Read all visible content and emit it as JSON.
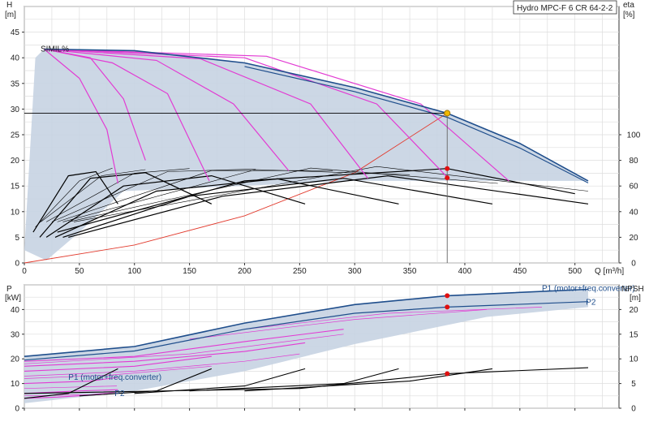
{
  "chart_data": [
    {
      "type": "line",
      "title": "Hydro MPC-F 6 CR 64-2-2",
      "top_left_tag": "SIMIL%",
      "xlabel": "Q [m³/h]",
      "x_ticks": [
        "0",
        "50",
        "100",
        "150",
        "200",
        "250",
        "300",
        "350",
        "400",
        "450",
        "500"
      ],
      "xlim": [
        0,
        540
      ],
      "left_axis": {
        "label": "H",
        "unit": "[m]",
        "ylim": [
          0,
          50
        ],
        "ticks": [
          "0",
          "5",
          "10",
          "15",
          "20",
          "25",
          "30",
          "35",
          "40",
          "45"
        ]
      },
      "right_axis": {
        "label": "eta",
        "unit": "[%]",
        "ylim_equiv": [
          0,
          200
        ],
        "ticks": [
          "0",
          "20",
          "40",
          "60",
          "80",
          "100"
        ]
      },
      "duty_point": {
        "Q": 384,
        "H": 29.2
      },
      "eff_points": [
        {
          "Q": 384,
          "H": 18.4
        },
        {
          "Q": 384,
          "H": 16.6
        }
      ],
      "grid": true,
      "series": [
        {
          "role": "envelope_max",
          "color": "#1f4e8c",
          "points": [
            [
              18,
              41.7
            ],
            [
              100,
              41.4
            ],
            [
              200,
              39.0
            ],
            [
              300,
              34.2
            ],
            [
              384,
              29.2
            ],
            [
              450,
              23.3
            ],
            [
              512,
              16.0
            ]
          ]
        },
        {
          "role": "envelope_lower",
          "color": "#1f4e8c",
          "points": [
            [
              200,
              38.3
            ],
            [
              300,
              33.4
            ],
            [
              384,
              28.4
            ],
            [
              450,
              22.4
            ],
            [
              512,
              15.6
            ]
          ]
        },
        {
          "role": "system_curve",
          "color": "#e23b2e",
          "points": [
            [
              0,
              0
            ],
            [
              100,
              3.5
            ],
            [
              200,
              9.2
            ],
            [
              300,
              17.6
            ],
            [
              384,
              29.2
            ]
          ]
        },
        {
          "role": "pump_speed_curves",
          "color": "#e23bd3",
          "curves": [
            [
              [
                18,
                41.7
              ],
              [
                50,
                36
              ],
              [
                75,
                26
              ],
              [
                85,
                15.5
              ]
            ],
            [
              [
                18,
                41.7
              ],
              [
                80,
                39
              ],
              [
                130,
                33
              ],
              [
                168,
                16
              ]
            ],
            [
              [
                18,
                41.7
              ],
              [
                120,
                39.5
              ],
              [
                190,
                31
              ],
              [
                240,
                18
              ]
            ],
            [
              [
                18,
                41.7
              ],
              [
                160,
                39.8
              ],
              [
                260,
                31
              ],
              [
                312,
                16.5
              ]
            ],
            [
              [
                18,
                41.7
              ],
              [
                200,
                40
              ],
              [
                320,
                31
              ],
              [
                385,
                16.5
              ]
            ],
            [
              [
                18,
                41.7
              ],
              [
                220,
                40.3
              ],
              [
                360,
                31
              ],
              [
                440,
                16
              ]
            ],
            [
              [
                18,
                41.7
              ],
              [
                60,
                40
              ],
              [
                90,
                32
              ],
              [
                110,
                20
              ]
            ]
          ]
        },
        {
          "role": "efficiency_curves",
          "color": "#000000",
          "curves": [
            [
              [
                8,
                6
              ],
              [
                40,
                17
              ],
              [
                65,
                17.8
              ],
              [
                85,
                11.5
              ]
            ],
            [
              [
                14,
                5
              ],
              [
                60,
                16.5
              ],
              [
                110,
                17.6
              ],
              [
                170,
                11.5
              ]
            ],
            [
              [
                20,
                5
              ],
              [
                90,
                15
              ],
              [
                170,
                17
              ],
              [
                255,
                11.5
              ]
            ],
            [
              [
                28,
                5
              ],
              [
                120,
                14
              ],
              [
                230,
                16.4
              ],
              [
                340,
                11.5
              ]
            ],
            [
              [
                35,
                5
              ],
              [
                150,
                13
              ],
              [
                290,
                16.5
              ],
              [
                425,
                11.5
              ]
            ],
            [
              [
                40,
                5
              ],
              [
                180,
                13
              ],
              [
                330,
                17
              ],
              [
                512,
                11.5
              ]
            ],
            [
              [
                30,
                6
              ],
              [
                200,
                16
              ],
              [
                384,
                18.4
              ],
              [
                500,
                13.5
              ]
            ]
          ]
        }
      ]
    },
    {
      "type": "line",
      "xlim": [
        0,
        540
      ],
      "left_axis": {
        "label": "P",
        "unit": "[kW]",
        "ylim": [
          0,
          50
        ],
        "ticks": [
          "0",
          "10",
          "20",
          "30",
          "40"
        ]
      },
      "right_axis": {
        "label": "NPSH",
        "unit": "[m]",
        "ylim": [
          0,
          25
        ],
        "ticks": [
          "0",
          "5",
          "10",
          "15",
          "20"
        ]
      },
      "annotations": [
        {
          "text": "P1 (motor+freq.converter)",
          "Q": 470,
          "P": 47.5
        },
        {
          "text": "P2",
          "Q": 510,
          "P": 42
        },
        {
          "text": "P1 (motor+freq.converter)",
          "Q": 40,
          "P": 11.5
        },
        {
          "text": "P2",
          "Q": 82,
          "P": 5
        }
      ],
      "duty_points": [
        {
          "Q": 384,
          "P": 45.6
        },
        {
          "Q": 384,
          "P": 41.0
        },
        {
          "Q": 384,
          "NPSH": 7.0
        }
      ],
      "series": [
        {
          "role": "P1_max",
          "color": "#1f4e8c",
          "points": [
            [
              0,
              21
            ],
            [
              100,
              25
            ],
            [
              200,
              34.5
            ],
            [
              300,
              42
            ],
            [
              384,
              45.6
            ],
            [
              512,
              48.2
            ]
          ]
        },
        {
          "role": "P2_max",
          "color": "#1f4e8c",
          "points": [
            [
              0,
              19.5
            ],
            [
              100,
              23.2
            ],
            [
              200,
              32
            ],
            [
              300,
              38.5
            ],
            [
              384,
              41.0
            ],
            [
              512,
              43.2
            ]
          ]
        },
        {
          "role": "P1_speed_curves",
          "color": "#e23bd3",
          "curves": [
            [
              [
                0,
                19
              ],
              [
                100,
                21
              ],
              [
                200,
                27
              ],
              [
                290,
                32
              ]
            ],
            [
              [
                0,
                17
              ],
              [
                100,
                19
              ],
              [
                200,
                23
              ],
              [
                255,
                26.5
              ]
            ],
            [
              [
                0,
                15
              ],
              [
                100,
                17
              ],
              [
                170,
                21
              ]
            ],
            [
              [
                0,
                10
              ],
              [
                60,
                11
              ],
              [
                85,
                12.5
              ]
            ],
            [
              [
                0,
                6
              ],
              [
                50,
                7
              ],
              [
                85,
                7.5
              ]
            ],
            [
              [
                0,
                4
              ],
              [
                30,
                4.5
              ],
              [
                84,
                6
              ]
            ]
          ]
        },
        {
          "role": "npsh_curves",
          "color": "#000000",
          "curves": [
            [
              [
                0,
                2
              ],
              [
                40,
                3
              ],
              [
                85,
                8
              ]
            ],
            [
              [
                50,
                2.5
              ],
              [
                120,
                3.5
              ],
              [
                170,
                8
              ]
            ],
            [
              [
                100,
                3
              ],
              [
                200,
                4.5
              ],
              [
                255,
                8
              ]
            ],
            [
              [
                150,
                3.5
              ],
              [
                290,
                5
              ],
              [
                340,
                8
              ]
            ],
            [
              [
                200,
                3.5
              ],
              [
                350,
                5.5
              ],
              [
                425,
                8
              ]
            ],
            [
              [
                0,
                3
              ],
              [
                250,
                4
              ],
              [
                384,
                7.0
              ],
              [
                512,
                8.2
              ]
            ]
          ]
        }
      ]
    }
  ]
}
